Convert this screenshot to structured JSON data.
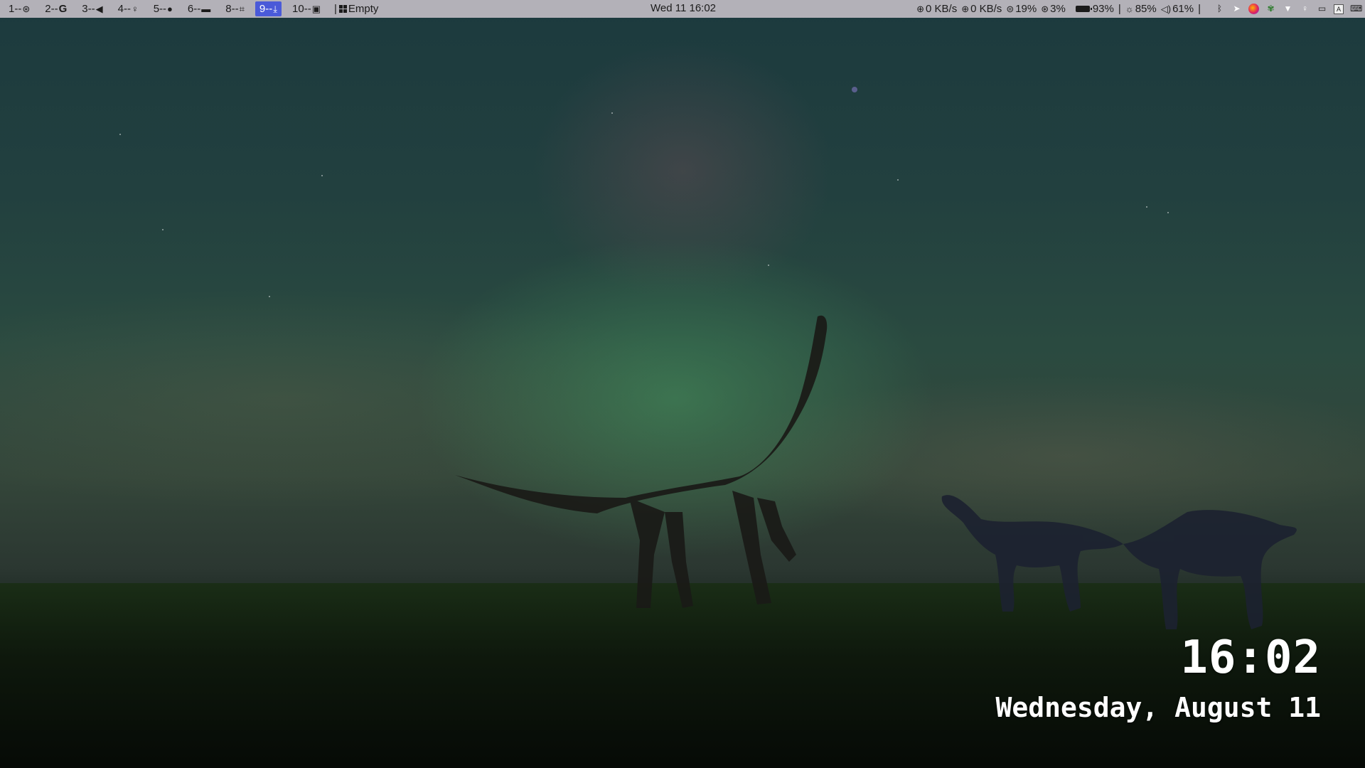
{
  "topbar": {
    "workspaces": [
      {
        "label": "1--",
        "icon": "dashboard-icon",
        "glyph": "⊛",
        "active": false
      },
      {
        "label": "2--",
        "icon": "google-icon",
        "glyph": "G",
        "active": false
      },
      {
        "label": "3--",
        "icon": "telegram-icon",
        "glyph": "◀",
        "active": false
      },
      {
        "label": "4--",
        "icon": "lightbulb-icon",
        "glyph": "♀",
        "active": false
      },
      {
        "label": "5--",
        "icon": "spotify-icon",
        "glyph": "●",
        "active": false
      },
      {
        "label": "6--",
        "icon": "folder-icon",
        "glyph": "▬",
        "active": false
      },
      {
        "label": "8--",
        "icon": "crop-icon",
        "glyph": "⌗",
        "active": false
      },
      {
        "label": "9--",
        "icon": "download-icon",
        "glyph": "⤓",
        "active": true
      },
      {
        "label": "10--",
        "icon": "window-icon",
        "glyph": "▣",
        "active": false
      }
    ],
    "separator": "|",
    "window_title": "Empty",
    "window_icon": "windows-icon",
    "center_clock": "Wed 11 16:02",
    "status": {
      "upload_speed": "0 KB/s",
      "download_speed": "0 KB/s",
      "memory": "19%",
      "cpu": "3%",
      "battery": "93%",
      "brightness": "85%",
      "volume": "61%",
      "divider": "|"
    },
    "tray_icons": [
      "bluetooth-icon",
      "telegram-icon",
      "firefox-icon",
      "xmonad-icon",
      "wifi-icon",
      "location-icon",
      "window-list-icon",
      "keyboard-layout-icon",
      "keyboard-icon"
    ]
  },
  "widget": {
    "time": "16:02",
    "date": "Wednesday, August 11"
  }
}
